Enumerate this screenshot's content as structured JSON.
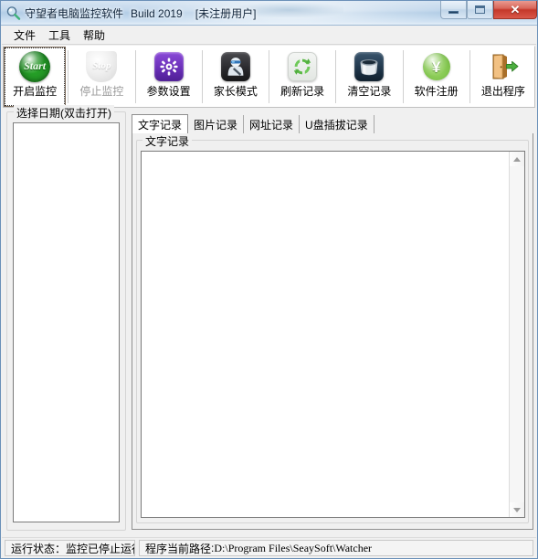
{
  "window": {
    "title": "守望者电脑监控软件",
    "build": "Build 2019",
    "registration": "[未注册用户]",
    "app_icon": "magnifier-icon",
    "controls": {
      "minimize": "−",
      "maximize": "□",
      "close": "✕"
    }
  },
  "menu": {
    "items": [
      {
        "label": "文件"
      },
      {
        "label": "工具"
      },
      {
        "label": "帮助"
      }
    ]
  },
  "toolbar": {
    "buttons": [
      {
        "label": "开启监控",
        "icon": "start-green-sphere-icon",
        "icon_text": "Start",
        "enabled": true,
        "focused": true
      },
      {
        "label": "停止监控",
        "icon": "stop-gray-sphere-icon",
        "icon_text": "Stop",
        "enabled": false,
        "focused": false
      },
      {
        "label": "参数设置",
        "icon": "gear-purple-icon",
        "enabled": true,
        "focused": false
      },
      {
        "label": "家长模式",
        "icon": "parent-robot-icon",
        "enabled": true,
        "focused": false
      },
      {
        "label": "刷新记录",
        "icon": "refresh-green-icon",
        "enabled": true,
        "focused": false
      },
      {
        "label": "清空记录",
        "icon": "trash-can-icon",
        "enabled": true,
        "focused": false
      },
      {
        "label": "软件注册",
        "icon": "yen-coin-icon",
        "enabled": true,
        "focused": false
      },
      {
        "label": "退出程序",
        "icon": "exit-door-icon",
        "enabled": true,
        "focused": false
      }
    ]
  },
  "left_panel": {
    "group_title": "选择日期(双击打开)",
    "list_items": []
  },
  "tabs": {
    "items": [
      {
        "label": "文字记录",
        "active": true
      },
      {
        "label": "图片记录",
        "active": false
      },
      {
        "label": "网址记录",
        "active": false
      },
      {
        "label": "U盘插拔记录",
        "active": false
      }
    ]
  },
  "content": {
    "group_title": "文字记录",
    "text_value": "",
    "scroll_up": "▲",
    "scroll_down": "▼"
  },
  "statusbar": {
    "run_state": "运行状态：监控已停止运行",
    "path_label": "程序当前路径",
    "path_sep": ":",
    "path_value": "D:\\Program Files\\SeaySoft\\Watcher"
  },
  "colors": {
    "titlebar": "#b3cde6",
    "close_button": "#c5382a",
    "start_icon": "#1f8c22",
    "gear_icon": "#6a2fb8",
    "yen_icon": "#7ec24a",
    "window_bg": "#f0f0f0"
  }
}
